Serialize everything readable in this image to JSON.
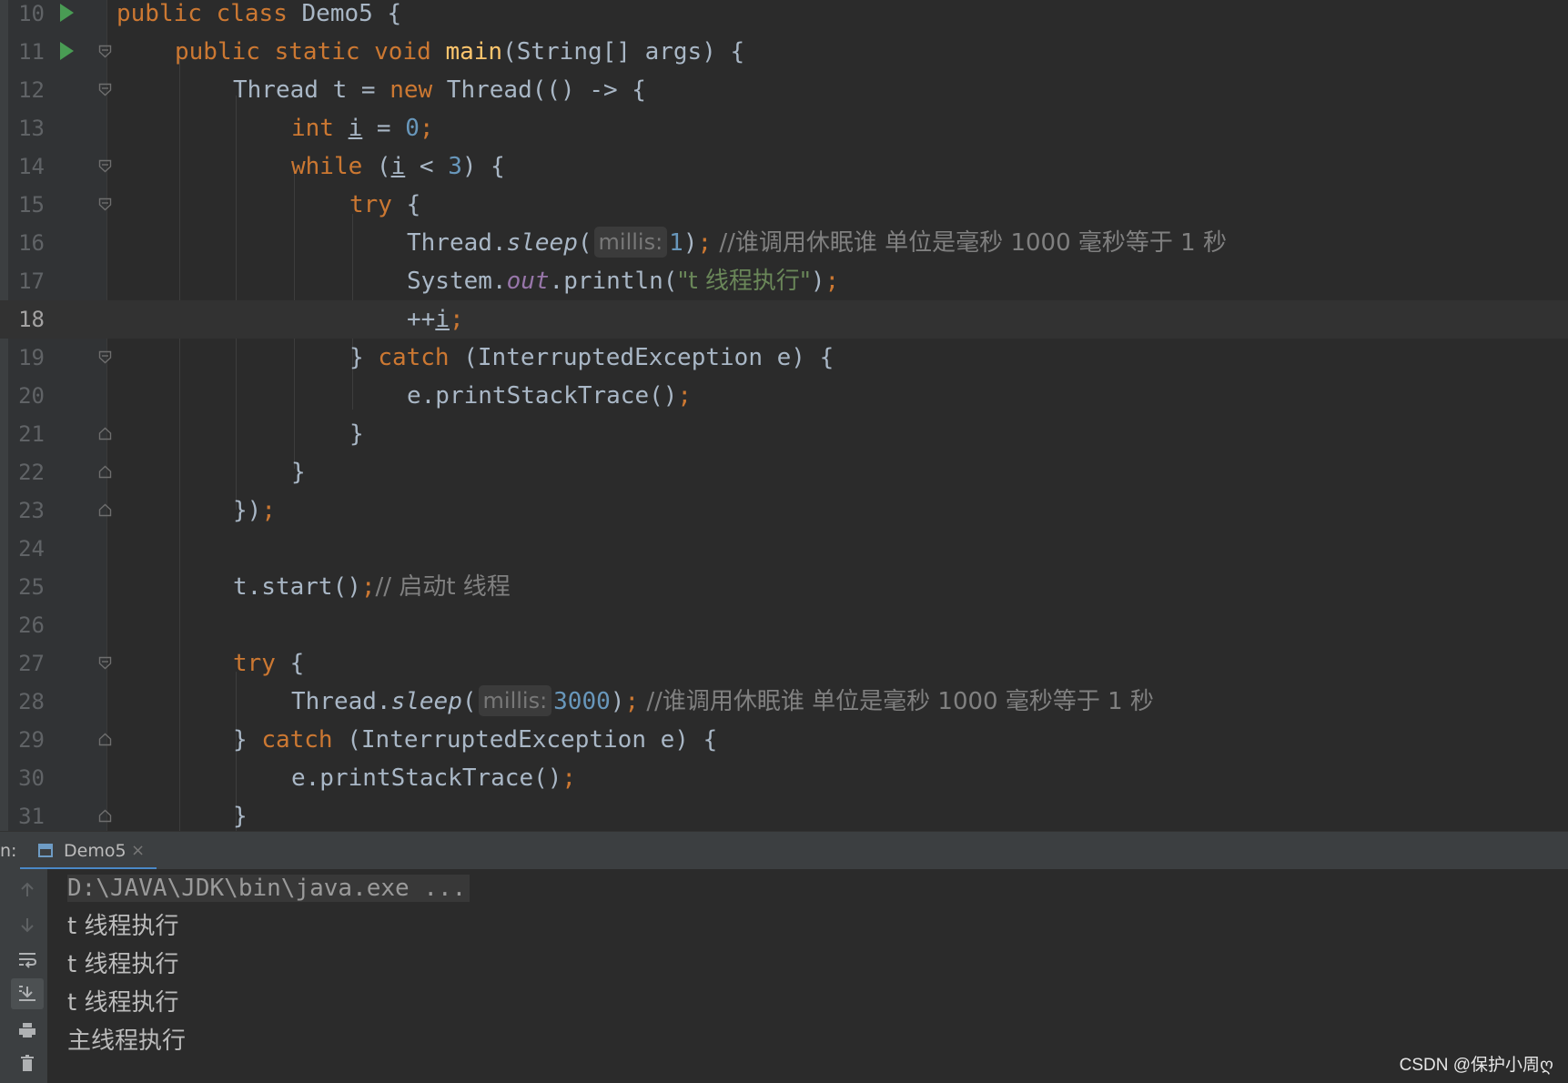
{
  "editor": {
    "current_line": "18",
    "line_numbers": [
      "10",
      "11",
      "12",
      "13",
      "14",
      "15",
      "16",
      "17",
      "18",
      "19",
      "20",
      "21",
      "22",
      "23",
      "24",
      "25",
      "26",
      "27",
      "28",
      "29",
      "30",
      "31"
    ],
    "tokens": {
      "public": "public",
      "class": "class",
      "demo5": "Demo5",
      "static": "static",
      "void": "void",
      "main": "main",
      "main_params": "(String[] args) {",
      "thread_decl": "Thread t = ",
      "new": "new",
      "thread_ctor": " Thread(() -> {",
      "int": "int",
      "var_i": "i",
      "assign": " = ",
      "zero": "0",
      "semi": ";",
      "while": "while",
      "while_open": " (",
      "lt": " < ",
      "three": "3",
      "while_close": ") {",
      "try": "try",
      "open_brace": " {",
      "thread_dot": "Thread.",
      "sleep": "sleep",
      "paren_open": "(",
      "hint_millis": "millis:",
      "one": "1",
      "paren_close": ")",
      "comment_sleep": " //谁调用休眠谁 单位是毫秒 1000 毫秒等于 1 秒",
      "system_dot": "System.",
      "out": "out",
      "println": ".println(",
      "str_t": "\"t 线程执行\"",
      "plus_plus": "++",
      "close_brace": "}",
      "catch": "catch",
      "catch_params": " (InterruptedException e) {",
      "print_trace": "e.printStackTrace()",
      "lambda_end": "})",
      "t_start": "t.start()",
      "comment_start": "// 启动t 线程",
      "three_thousand": "3000"
    }
  },
  "run_window": {
    "label": "n:",
    "tab_label": "Demo5",
    "tab_close": "×",
    "lines": [
      "D:\\JAVA\\JDK\\bin\\java.exe ...",
      "t 线程执行",
      "t 线程执行",
      "t 线程执行",
      "主线程执行"
    ]
  },
  "watermark": "CSDN @保护小周ღ",
  "colors": {
    "background": "#2b2b2b",
    "keyword": "#cc7832",
    "number": "#6897bb",
    "string": "#6a8759",
    "comment": "#808080",
    "method": "#ffc66d",
    "static_field": "#9876aa"
  }
}
